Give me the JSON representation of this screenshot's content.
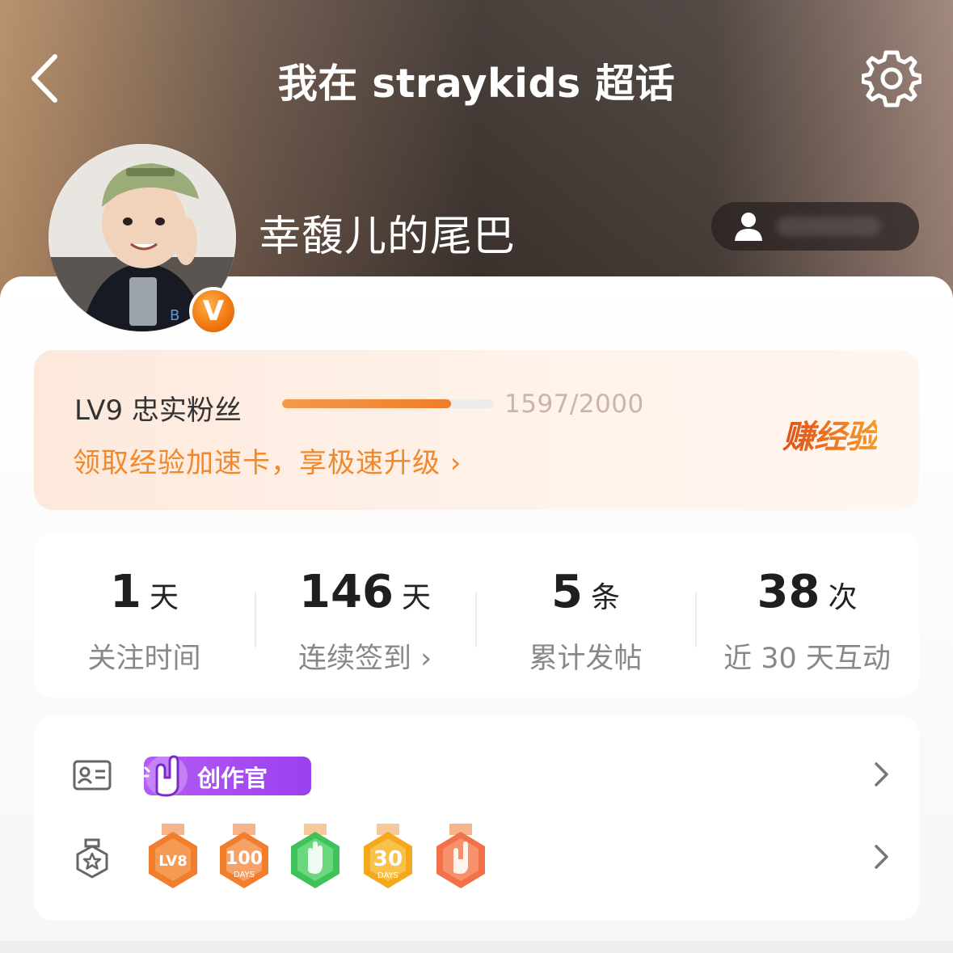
{
  "header": {
    "title": "我在 straykids 超话",
    "back_icon": "chevron-left-icon",
    "settings_icon": "gear-icon"
  },
  "profile": {
    "username": "幸馥儿的尾巴",
    "vip_badge": "V",
    "avatar_alt": "avatar-photo"
  },
  "level": {
    "name": "LV9 忠实粉丝",
    "progress_text": "1597/2000",
    "progress_fraction": 0.7985,
    "promo": "领取经验加速卡，享极速升级 ›",
    "earn_label": "赚经验"
  },
  "stats": [
    {
      "value": "1",
      "unit": "天",
      "label": "关注时间"
    },
    {
      "value": "146",
      "unit": "天",
      "label": "连续签到 ›"
    },
    {
      "value": "5",
      "unit": "条",
      "label": "累计发帖"
    },
    {
      "value": "38",
      "unit": "次",
      "label": "近 30 天互动"
    }
  ],
  "identity_row": {
    "icon": "id-card-icon",
    "badge_label": "创作官"
  },
  "medals_row": {
    "icon": "medal-star-icon",
    "medals": [
      {
        "name": "lv-medal",
        "text": "LV8",
        "color": "#f07e2d"
      },
      {
        "name": "100-days-medal",
        "text": "100",
        "subtext": "DAYS",
        "color": "#f07e2d"
      },
      {
        "name": "hand-medal",
        "text": "",
        "color": "#3fc25a"
      },
      {
        "name": "30-days-medal",
        "text": "30",
        "subtext": "DAYS",
        "color": "#f5a81c"
      },
      {
        "name": "rock-hand-medal",
        "text": "",
        "color": "#f2714a"
      }
    ]
  },
  "colors": {
    "accent_orange": "#f0882c",
    "progress_fill": "#f07c2a",
    "creator_purple": "#9a40ee"
  }
}
